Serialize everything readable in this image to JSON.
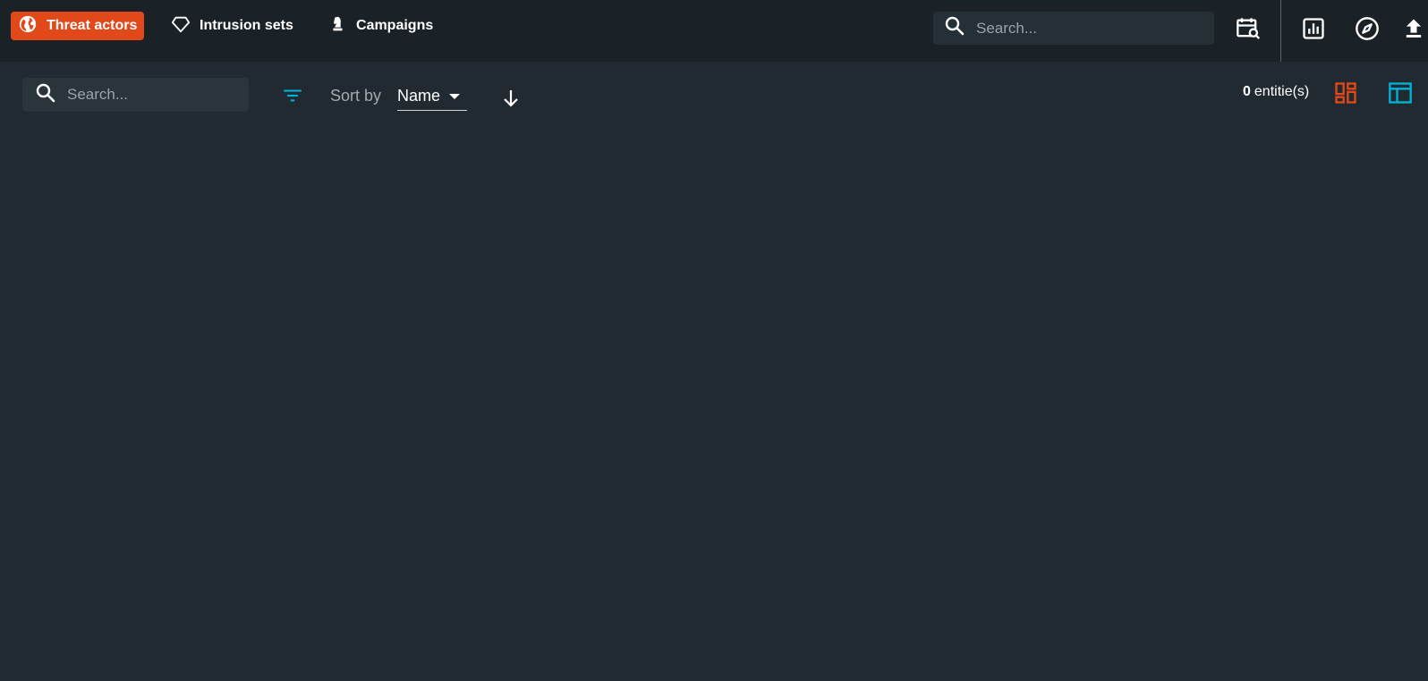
{
  "nav": {
    "tabs": [
      {
        "label": "Threat actors",
        "icon": "globe-icon",
        "active": true
      },
      {
        "label": "Intrusion sets",
        "icon": "diamond-icon",
        "active": false
      },
      {
        "label": "Campaigns",
        "icon": "chess-knight-icon",
        "active": false
      }
    ]
  },
  "topbar": {
    "search_placeholder": "Search...",
    "icons": [
      "calendar-search-icon",
      "report-chart-icon",
      "compass-icon",
      "upload-icon"
    ]
  },
  "toolbar": {
    "search_placeholder": "Search...",
    "filter_icon": "filter-icon",
    "sort_label": "Sort by",
    "sort_value": "Name",
    "sort_direction_icon": "arrow-down-icon",
    "entity_count": "0",
    "entity_label": "entitie(s)",
    "view_icons": [
      "cards-view-icon",
      "list-view-icon"
    ]
  },
  "colors": {
    "accent": "#e1491b",
    "secondary": "#00b1d8",
    "background": "#222a31",
    "topbar": "#1b2227"
  }
}
